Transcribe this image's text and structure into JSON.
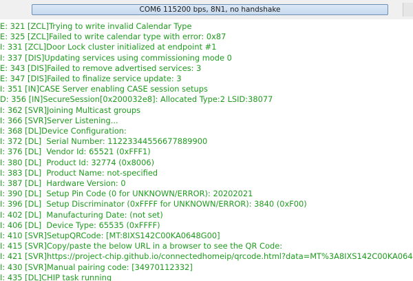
{
  "window": {
    "title": "COM6 115200 bps, 8N1, no handshake"
  },
  "colors": {
    "log_text": "#1f9b1f",
    "title_field": "#c7daef"
  },
  "log": {
    "lines": [
      "E: 321 [ZCL]Trying to write invalid Calendar Type",
      "E: 325 [ZCL]Failed to write calendar type with error: 0x87",
      "I: 331 [ZCL]Door Lock cluster initialized at endpoint #1",
      "I: 337 [DIS]Updating services using commissioning mode 0",
      "E: 343 [DIS]Failed to remove advertised services: 3",
      "E: 347 [DIS]Failed to finalize service update: 3",
      "I: 351 [IN]CASE Server enabling CASE session setups",
      "D: 356 [IN]SecureSession[0x200032e8]: Allocated Type:2 LSID:38077",
      "I: 362 [SVR]Joining Multicast groups",
      "I: 366 [SVR]Server Listening...",
      "I: 368 [DL]Device Configuration:",
      "I: 372 [DL]  Serial Number: 11223344556677889900",
      "I: 376 [DL]  Vendor Id: 65521 (0xFFF1)",
      "I: 380 [DL]  Product Id: 32774 (0x8006)",
      "I: 383 [DL]  Product Name: not-specified",
      "I: 387 [DL]  Hardware Version: 0",
      "I: 390 [DL]  Setup Pin Code (0 for UNKNOWN/ERROR): 20202021",
      "I: 396 [DL]  Setup Discriminator (0xFFFF for UNKNOWN/ERROR): 3840 (0xF00)",
      "I: 402 [DL]  Manufacturing Date: (not set)",
      "I: 406 [DL]  Device Type: 65535 (0xFFFF)",
      "I: 410 [SVR]SetupQRCode: [MT:8IXS142C00KA0648G00]",
      "I: 415 [SVR]Copy/paste the below URL in a browser to see the QR Code:",
      "I: 421 [SVR]https://project-chip.github.io/connectedhomeip/qrcode.html?data=MT%3A8IXS142C00KA0648G00",
      "I: 430 [SVR]Manual pairing code: [34970112332]",
      "I: 435 [DL]CHIP task running"
    ]
  }
}
